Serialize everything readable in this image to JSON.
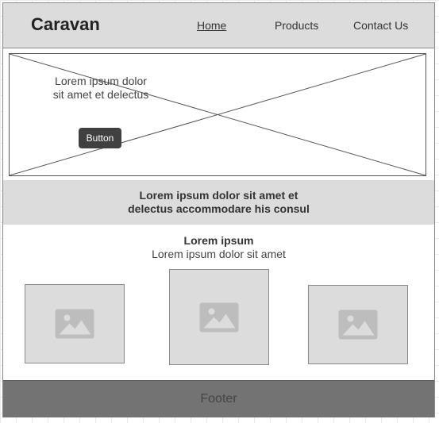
{
  "header": {
    "brand": "Caravan",
    "nav": [
      "Home",
      "Products",
      "Contact Us"
    ]
  },
  "hero": {
    "text": "Lorem ipsum dolor sit amet et delectus",
    "button_label": "Button"
  },
  "band": {
    "line1": "Lorem ipsum dolor sit amet et",
    "line2": "delectus accommodare his consul"
  },
  "features": {
    "title": "Lorem ipsum",
    "subtitle": "Lorem ipsum dolor sit amet",
    "cards": [
      "image-placeholder",
      "image-placeholder",
      "image-placeholder"
    ]
  },
  "footer": {
    "label": "Footer"
  },
  "colors": {
    "header_bg": "#dcdcdc",
    "button_bg": "#404040",
    "footer_bg": "#737373",
    "placeholder_icon": "#bdbdbd"
  }
}
